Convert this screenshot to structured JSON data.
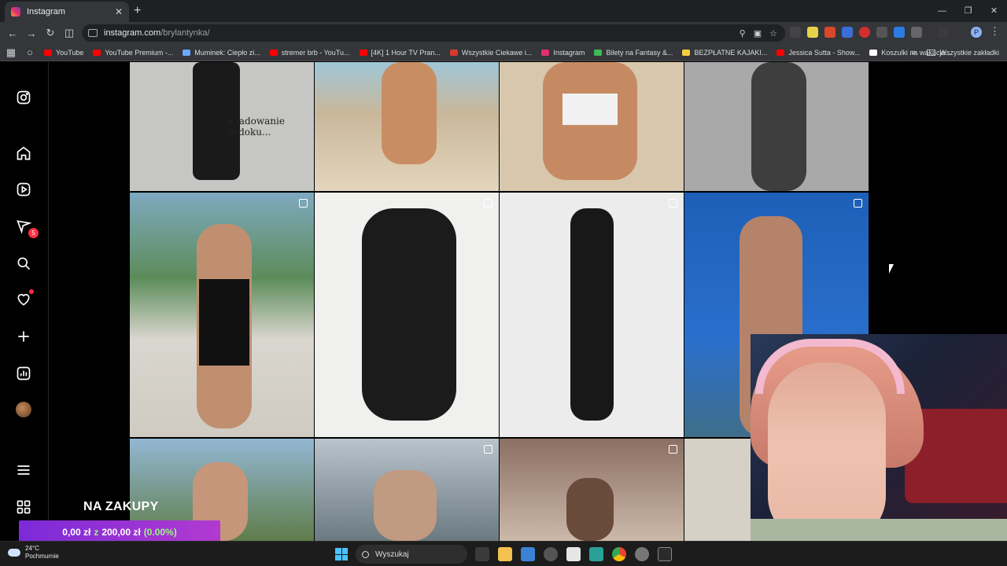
{
  "browser": {
    "tab_title": "Instagram",
    "tab_close": "✕",
    "new_tab": "+",
    "window_controls": [
      "—",
      "❐",
      "✕"
    ],
    "url_host": "instagram.com",
    "url_path": "/brylantynka/",
    "profile_initial": "P",
    "bookmarks": [
      {
        "label": "YouTube",
        "color": "#ff0000"
      },
      {
        "label": "YouTube Premium -...",
        "color": "#ff0000"
      },
      {
        "label": "Muminek: Ciepło zi...",
        "color": "#6aa7ff"
      },
      {
        "label": "stremer brb - YouTu...",
        "color": "#ff0000"
      },
      {
        "label": "[4K] 1 Hour TV Pran...",
        "color": "#ff0000"
      },
      {
        "label": "Wszystkie Ciekawe i...",
        "color": "#d83a2a"
      },
      {
        "label": "Instagram",
        "color": "#e1306c"
      },
      {
        "label": "Bilety na Fantasy &...",
        "color": "#3cba54"
      },
      {
        "label": "BEZPŁATNE KAJAKI...",
        "color": "#f4d03f"
      },
      {
        "label": "Jessica Sutta - Show...",
        "color": "#ff0000"
      },
      {
        "label": "Koszulki na wakacje...",
        "color": "#ffffff"
      }
    ],
    "bookmarks_more": "»",
    "all_bookmarks": "Wszystkie zakładki"
  },
  "instagram": {
    "nav": [
      {
        "name": "instagram-logo-icon",
        "badge": ""
      },
      {
        "name": "home-icon",
        "badge": ""
      },
      {
        "name": "reels-icon",
        "badge": ""
      },
      {
        "name": "messages-icon",
        "badge": "5"
      },
      {
        "name": "search-icon",
        "badge": ""
      },
      {
        "name": "notifications-icon",
        "badge": ""
      },
      {
        "name": "create-icon",
        "badge": ""
      },
      {
        "name": "dashboard-icon",
        "badge": ""
      },
      {
        "name": "profile-avatar",
        "badge": ""
      },
      {
        "name": "more-menu-icon",
        "badge": ""
      },
      {
        "name": "threads-apps-icon",
        "badge": ""
      }
    ],
    "loading_overlay_text": "a ladowanie widoku..."
  },
  "stream_overlay": {
    "promo_title": "NA ZAKUPY",
    "promo_current": "0,00 zł",
    "promo_of": "z",
    "promo_goal": "200,00 zł",
    "promo_percent": "(0.00%)"
  },
  "taskbar": {
    "temperature": "24°C",
    "weather": "Pochmurnie",
    "search_placeholder": "Wyszukaj"
  }
}
